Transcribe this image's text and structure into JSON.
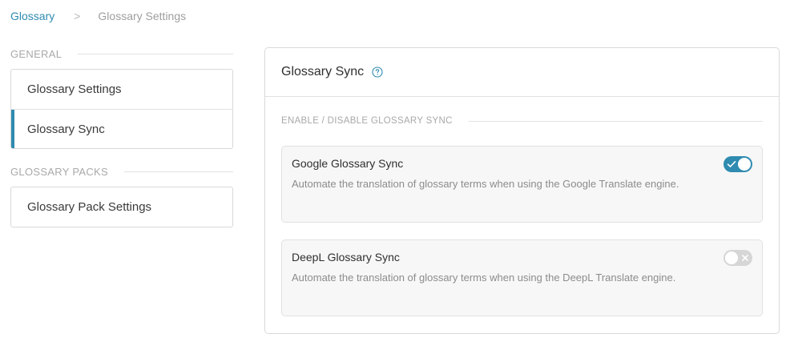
{
  "breadcrumb": {
    "root": "Glossary",
    "separator": ">",
    "current": "Glossary Settings"
  },
  "sidebar": {
    "general_label": "GENERAL",
    "general_items": [
      {
        "label": "Glossary Settings",
        "active": false
      },
      {
        "label": "Glossary Sync",
        "active": true
      }
    ],
    "packs_label": "GLOSSARY PACKS",
    "packs_items": [
      {
        "label": "Glossary Pack Settings",
        "active": false
      }
    ]
  },
  "panel": {
    "title": "Glossary Sync",
    "help_icon": "question-circle-icon",
    "section_label": "ENABLE / DISABLE GLOSSARY SYNC",
    "cards": [
      {
        "title": "Google Glossary Sync",
        "description": "Automate the translation of glossary terms when using the Google Translate engine.",
        "enabled": true
      },
      {
        "title": "DeepL Glossary Sync",
        "description": "Automate the translation of glossary terms when using the DeepL Translate engine.",
        "enabled": false
      }
    ]
  },
  "colors": {
    "accent": "#2f8bb0",
    "toggle_off": "#d6d6d6",
    "card_bg": "#f7f7f7"
  }
}
